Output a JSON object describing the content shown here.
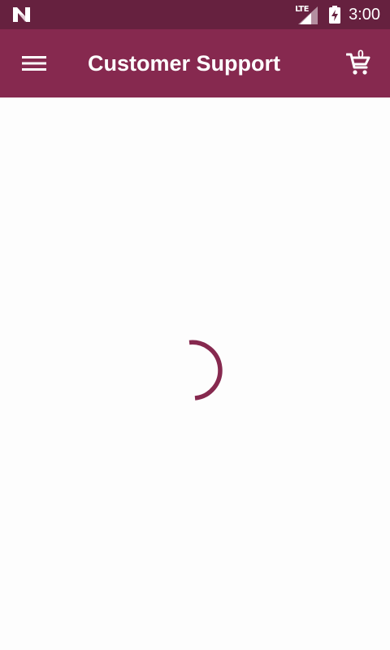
{
  "status_bar": {
    "network_label": "LTE",
    "time": "3:00",
    "icons": [
      "notification-n-icon",
      "signal-icon",
      "battery-charging-icon"
    ]
  },
  "app_bar": {
    "title": "Customer Support",
    "menu_icon": "hamburger-menu-icon",
    "cart_icon": "shopping-cart-icon",
    "cart_count": "0"
  },
  "content": {
    "state": "loading",
    "spinner_icon": "loading-spinner-icon"
  },
  "colors": {
    "status_bar": "#66213f",
    "app_bar": "#86294f",
    "accent": "#86294f",
    "background": "#fdfdfd",
    "on_primary": "#ffffff"
  }
}
